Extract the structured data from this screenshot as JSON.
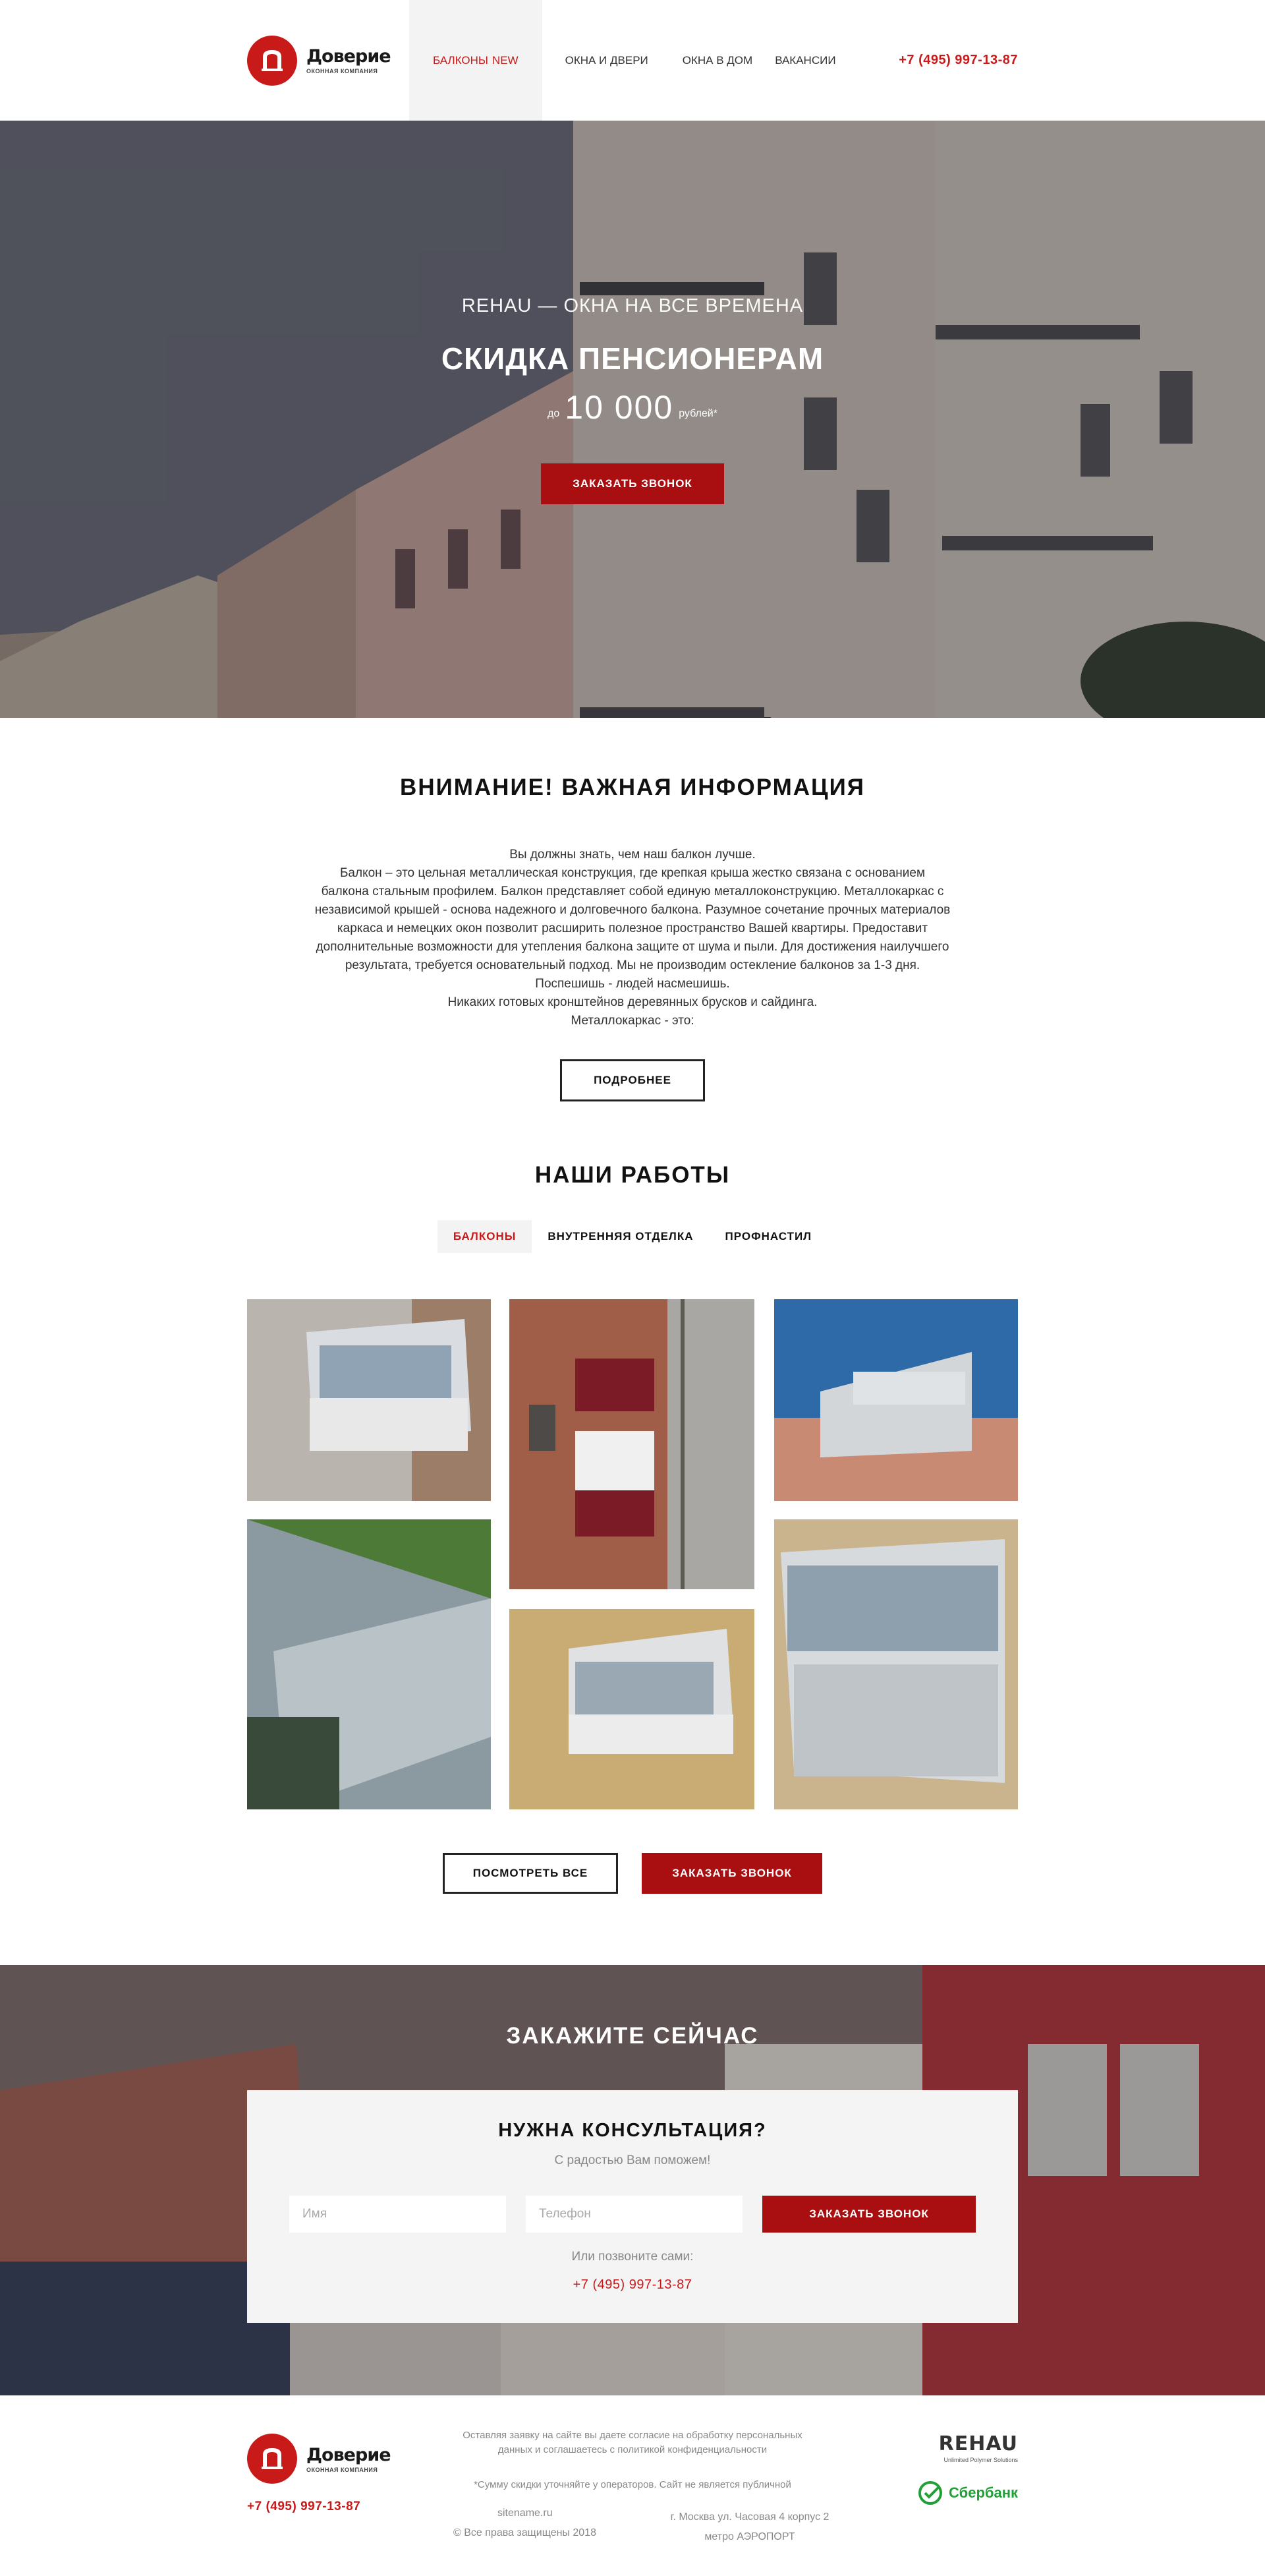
{
  "header": {
    "logo_name": "Доверие",
    "logo_sub": "ОКОННАЯ КОМПАНИЯ",
    "nav": [
      {
        "label": "БАЛКОНЫ",
        "badge": "NEW"
      },
      {
        "label": "ОКНА И ДВЕРИ"
      },
      {
        "label": "ОКНА В ДОМ"
      },
      {
        "label": "ВАКАНСИИ"
      }
    ],
    "phone": "+7 (495) 997-13-87"
  },
  "hero": {
    "subtitle": "REHAU — ОКНА НА ВСЕ ВРЕМЕНА",
    "title": "СКИДКА ПЕНСИОНЕРАМ",
    "prefix": "до",
    "amount": "10 000",
    "suffix": "рублей*",
    "button": "ЗАКАЗАТЬ ЗВОНОК"
  },
  "info": {
    "title": "ВНИМАНИЕ! ВАЖНАЯ ИНФОРМАЦИЯ",
    "lines": [
      "Вы должны знать, чем наш балкон лучше.",
      "Балкон – это цельная металлическая конструкция, где крепкая крыша жестко связана с основанием балкона стальным профилем. Балкон представляет собой единую металлоконструкцию. Металлокаркас с независимой крышей - основа надежного и долговечного балкона. Разумное сочетание прочных материалов каркаса и немецких окон позволит расширить полезное пространство Вашей квартиры. Предоставит дополнительные возможности для утепления балкона защите от шума и пыли. Для достижения наилучшего результата, требуется основательный подход. Мы не производим остекление балконов за 1-3 дня. Поспешишь - людей насмешишь.",
      "Никаких готовых кронштейнов деревянных брусков и сайдинга.",
      "Металлокаркас - это:"
    ],
    "button": "ПОДРОБНЕЕ"
  },
  "works": {
    "title": "НАШИ РАБОТЫ",
    "tabs": [
      "БАЛКОНЫ",
      "ВНУТРЕННЯЯ ОТДЕЛКА",
      "ПРОФНАСТИЛ"
    ],
    "button_all": "ПОСМОТРЕТЬ ВСЕ",
    "button_call": "ЗАКАЗАТЬ ЗВОНОК"
  },
  "order": {
    "title": "ЗАКАЖИТЕ СЕЙЧАС",
    "card_title": "НУЖНА КОНСУЛЬТАЦИЯ?",
    "card_sub": "С радостью Вам поможем!",
    "name_placeholder": "Имя",
    "phone_placeholder": "Телефон",
    "button": "ЗАКАЗАТЬ ЗВОНОК",
    "call_text": "Или позвоните сами:",
    "phone": "+7 (495) 997-13-87"
  },
  "footer": {
    "logo_name": "Доверие",
    "logo_sub": "ОКОННАЯ КОМПАНИЯ",
    "phone": "+7 (495) 997-13-87",
    "consent_text": "Оставляя заявку на сайте вы даете согласие на обработку персональных данных и соглашаетесь с",
    "policy_link": "политикой конфиденциальности",
    "note": "*Сумму скидки уточняйте у операторов. Сайт не является публичной",
    "site": "sitename.ru",
    "copyright": "© Все права защищены 2018",
    "address": "г. Москва ул. Часовая 4 корпус 2",
    "metro": "метро АЭРОПОРТ",
    "rehau": "REHAU",
    "rehau_sub": "Unlimited Polymer Solutions",
    "sber": "Сбербанк"
  },
  "colors": {
    "accent": "#c91a1a",
    "button_red": "#a90f10",
    "tab_bg": "#f3f3f3"
  }
}
